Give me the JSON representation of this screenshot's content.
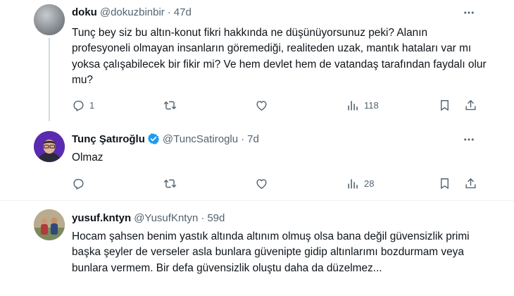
{
  "tweets": [
    {
      "name": "doku",
      "handle": "@dokuzbinbir",
      "separator": "·",
      "time": "47d",
      "text": "Tunç bey siz bu altın-konut fikri hakkında ne düşünüyorsunuz peki? Alanın profesyoneli olmayan insanların göremediği, realiteden uzak, mantık hataları var mı yoksa çalışabilecek bir fikir mi? Ve hem devlet hem de vatandaş tarafından faydalı olur mu?",
      "reply_count": "1",
      "retweet_count": "",
      "like_count": "",
      "views_count": "118"
    },
    {
      "name": "Tunç Şatıroğlu",
      "handle": "@TuncSatiroglu",
      "separator": "·",
      "time": "7d",
      "text": "Olmaz",
      "reply_count": "",
      "retweet_count": "",
      "like_count": "",
      "views_count": "28",
      "verified_color": "#1d9bf0"
    },
    {
      "name": "yusuf.kntyn",
      "handle": "@YusufKntyn",
      "separator": "·",
      "time": "59d",
      "text": "Hocam şahsen benim yastık altında altınım olmuş olsa bana değil güvensizlik primi başka şeyler de verseler asla bunlara güvenipte gidip altınlarımı bozdurmam veya bunlara vermem. Bir defa güvensizlik oluştu daha da düzelmez..."
    }
  ],
  "icons": [
    "more-icon",
    "reply-icon",
    "retweet-icon",
    "like-icon",
    "views-icon",
    "bookmark-icon",
    "share-icon",
    "verified-icon"
  ],
  "colors": {
    "text": "#0f1419",
    "secondary": "#536471",
    "accent": "#1d9bf0",
    "divider": "#eff3f4"
  }
}
